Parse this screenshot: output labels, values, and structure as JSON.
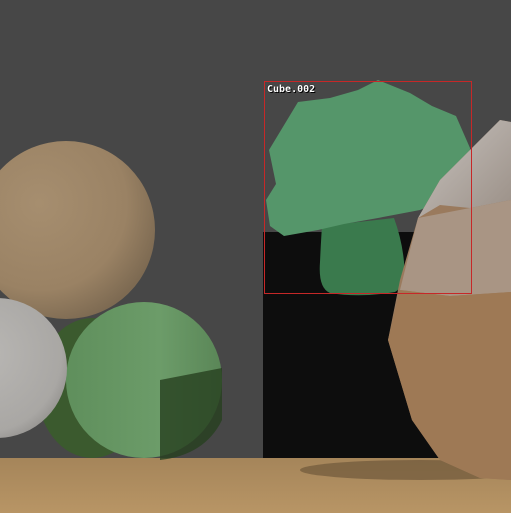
{
  "viewport": {
    "background_color": "#474747",
    "floor_color": "#b08e5f",
    "doorway_color": "#0d0d0d"
  },
  "objects": [
    {
      "kind": "sphere",
      "color": "#a0896a"
    },
    {
      "kind": "sphere",
      "color": "#b3b1ae"
    },
    {
      "kind": "cylinder",
      "color": "#6a9a68"
    },
    {
      "kind": "broccoli-mesh",
      "color": "#55966a"
    },
    {
      "kind": "rock-mesh",
      "color": "#9a7a5d"
    }
  ],
  "selection": {
    "object_name": "Cube.002",
    "outline_color": "#c62828"
  }
}
